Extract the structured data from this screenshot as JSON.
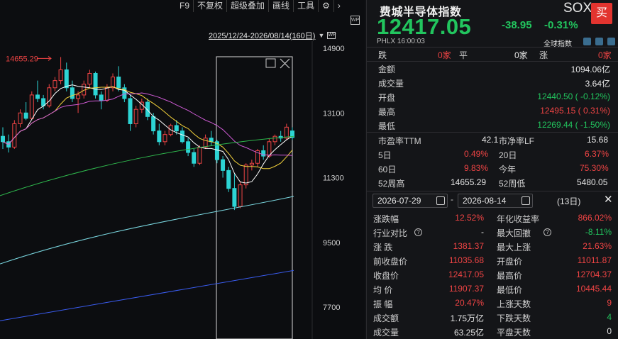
{
  "toolbar": {
    "items": [
      "F9",
      "不复权",
      "超级叠加",
      "画线",
      "工具"
    ],
    "gear_icon": "gear-icon",
    "arrow_icon": "chevron-right-icon"
  },
  "chart": {
    "range_text": "2025/12/24-2026/08/14(160日)",
    "max_label": "14655.29",
    "y_ticks": [
      "14900",
      "13100",
      "11300",
      "9500",
      "7700"
    ],
    "y_tick_values": [
      14900,
      13100,
      11300,
      9500,
      7700
    ]
  },
  "chart_data": {
    "type": "candlestick",
    "y_range": [
      7000,
      14900
    ],
    "ma_colors": {
      "ma5": "#ffffff",
      "ma10": "#f5d33b",
      "ma20": "#d05bd6",
      "ma60": "#2fb84d",
      "ma120": "#7ad7e0",
      "ma250": "#3a5cf0"
    },
    "candles": [
      [
        12450,
        12700,
        12100,
        12300
      ],
      [
        12300,
        12500,
        12000,
        12150
      ],
      [
        12150,
        12900,
        12100,
        12800
      ],
      [
        12800,
        13200,
        12700,
        13100
      ],
      [
        13100,
        13400,
        12900,
        12950
      ],
      [
        12950,
        13700,
        12900,
        13600
      ],
      [
        13600,
        14000,
        13400,
        13500
      ],
      [
        13500,
        13600,
        13200,
        13300
      ],
      [
        13300,
        13900,
        13250,
        13800
      ],
      [
        13800,
        14100,
        13700,
        14000
      ],
      [
        14000,
        14655,
        13900,
        14300
      ],
      [
        14300,
        14500,
        13700,
        13800
      ],
      [
        13800,
        14000,
        13400,
        13500
      ],
      [
        13500,
        13700,
        13100,
        13600
      ],
      [
        13600,
        14000,
        13500,
        13900
      ],
      [
        13900,
        14300,
        13800,
        14200
      ],
      [
        14200,
        14250,
        13500,
        13600
      ],
      [
        13600,
        13700,
        13200,
        13450
      ],
      [
        13450,
        13900,
        13400,
        13800
      ],
      [
        13800,
        14200,
        13700,
        14100
      ],
      [
        14100,
        14400,
        13700,
        13800
      ],
      [
        13800,
        13900,
        13400,
        13500
      ],
      [
        13500,
        13600,
        12600,
        12800
      ],
      [
        12800,
        13300,
        12700,
        13200
      ],
      [
        13200,
        13500,
        13100,
        13400
      ],
      [
        13400,
        13500,
        12900,
        13000
      ],
      [
        13000,
        13100,
        12500,
        12600
      ],
      [
        12600,
        12800,
        12200,
        12300
      ],
      [
        12300,
        12600,
        12200,
        12500
      ],
      [
        12500,
        12800,
        12450,
        12750
      ],
      [
        12750,
        12900,
        12500,
        12600
      ],
      [
        12600,
        12700,
        12250,
        12300
      ],
      [
        12300,
        12400,
        11900,
        12000
      ],
      [
        12000,
        12100,
        11600,
        11700
      ],
      [
        11700,
        12200,
        11650,
        12150
      ],
      [
        12150,
        12500,
        12100,
        12400
      ],
      [
        12400,
        12600,
        12200,
        12300
      ],
      [
        12300,
        12350,
        11700,
        11800
      ],
      [
        11800,
        11900,
        11300,
        11500
      ],
      [
        11500,
        11600,
        10900,
        11000
      ],
      [
        11000,
        11400,
        10400,
        10500
      ],
      [
        10500,
        11200,
        10450,
        11100
      ],
      [
        11100,
        11700,
        11000,
        11650
      ],
      [
        11650,
        11800,
        11500,
        11700
      ],
      [
        11700,
        12100,
        11600,
        12050
      ],
      [
        12050,
        12200,
        11800,
        11900
      ],
      [
        11900,
        12400,
        11850,
        12300
      ],
      [
        12300,
        12500,
        12200,
        12450
      ],
      [
        12450,
        12600,
        12300,
        12400
      ],
      [
        12400,
        12800,
        12350,
        12704
      ],
      [
        12600,
        12700,
        12350,
        12417
      ]
    ]
  },
  "panel": {
    "name": "费城半导体指数",
    "code": "SOX",
    "buy_label": "买",
    "price": "12417.05",
    "change": "-38.95",
    "change_pct": "-0.31%",
    "exchange": "PHLX  16:00:03",
    "global_label": "全球指数",
    "breadth": {
      "down_label": "跌",
      "down_val": "0家",
      "flat_label": "平",
      "flat_val": "0家",
      "up_label": "涨",
      "up_val": "0家"
    },
    "stats": [
      {
        "label": "金额",
        "value": "1094.06亿",
        "cls": "white"
      },
      {
        "label": "成交量",
        "value": "3.64亿",
        "cls": "white"
      },
      {
        "label": "开盘",
        "value": "12440.50 ( -0.12%)",
        "cls": "green"
      },
      {
        "label": "最高",
        "value": "12495.15 ( 0.31%)",
        "cls": "red"
      },
      {
        "label": "最低",
        "value": "12269.44 ( -1.50%)",
        "cls": "green"
      }
    ],
    "valuation": {
      "pe_label": "市盈率TTM",
      "pe_value": "42.1",
      "pb_label": "市净率LF",
      "pb_value": "15.68",
      "d5_label": "5日",
      "d5_value": "0.49%",
      "d20_label": "20日",
      "d20_value": "6.37%",
      "d60_label": "60日",
      "d60_value": "9.83%",
      "ytd_label": "今年",
      "ytd_value": "75.30%",
      "h52_label": "52周高",
      "h52_value": "14655.29",
      "l52_label": "52周低",
      "l52_value": "5480.05"
    },
    "range": {
      "start": "2026-07-29",
      "end": "2026-08-14",
      "days": "(13日)",
      "close_icon": "close-icon"
    },
    "interval_rows": [
      {
        "l1": "涨跌幅",
        "v1": "12.52%",
        "c1": "red",
        "l2": "年化收益率",
        "v2": "866.02%",
        "c2": "red"
      },
      {
        "l1": "行业对比",
        "q1": true,
        "v1": "-",
        "c1": "white",
        "l2": "最大回撤",
        "q2": true,
        "v2": "-8.11%",
        "c2": "green"
      },
      {
        "l1": "涨 跌",
        "v1": "1381.37",
        "c1": "red",
        "l2": "最大上涨",
        "v2": "21.63%",
        "c2": "red"
      },
      {
        "l1": "前收盘价",
        "v1": "11035.68",
        "c1": "red",
        "l2": "开盘价",
        "v2": "11011.87",
        "c2": "red"
      },
      {
        "l1": "收盘价",
        "v1": "12417.05",
        "c1": "red",
        "l2": "最高价",
        "v2": "12704.37",
        "c2": "red"
      },
      {
        "l1": "均 价",
        "v1": "11907.37",
        "c1": "red",
        "l2": "最低价",
        "v2": "10445.44",
        "c2": "red"
      },
      {
        "l1": "振 幅",
        "v1": "20.47%",
        "c1": "red",
        "l2": "上涨天数",
        "v2": "9",
        "c2": "red"
      },
      {
        "l1": "成交额",
        "v1": "1.75万亿",
        "c1": "white",
        "l2": "下跌天数",
        "v2": "4",
        "c2": "green"
      },
      {
        "l1": "成交量",
        "v1": "63.25亿",
        "c1": "white",
        "l2": "平盘天数",
        "v2": "0",
        "c2": "white"
      }
    ]
  }
}
